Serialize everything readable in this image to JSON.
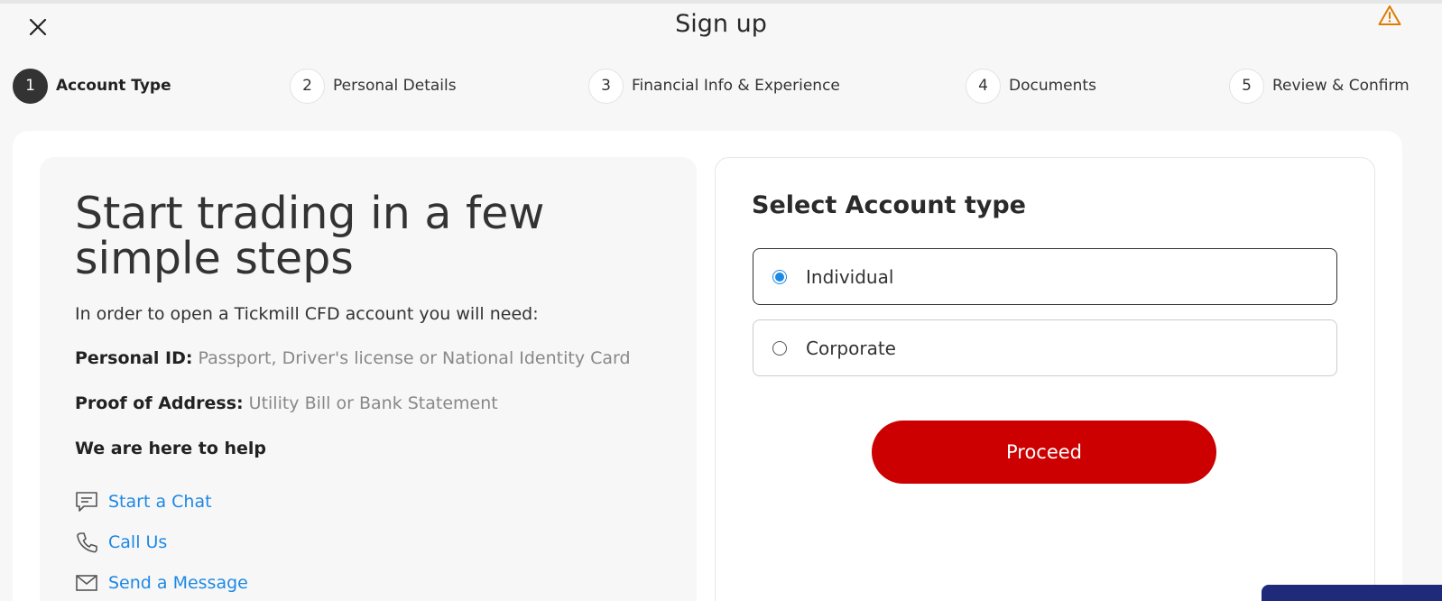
{
  "header": {
    "title": "Sign up"
  },
  "steps": [
    {
      "num": "1",
      "label": "Account Type",
      "active": true
    },
    {
      "num": "2",
      "label": "Personal Details",
      "active": false
    },
    {
      "num": "3",
      "label": "Financial Info & Experience",
      "active": false
    },
    {
      "num": "4",
      "label": "Documents",
      "active": false
    },
    {
      "num": "5",
      "label": "Review & Confirm",
      "active": false
    }
  ],
  "info": {
    "headline": "Start trading in a few simple steps",
    "intro": "In order to open a Tickmill CFD account you will need:",
    "requirements": [
      {
        "label": "Personal ID:",
        "value": "Passport, Driver's license or National Identity Card"
      },
      {
        "label": "Proof of Address:",
        "value": "Utility Bill or Bank Statement"
      }
    ],
    "help_heading": "We are here to help",
    "contacts": [
      {
        "label": "Start a Chat",
        "icon": "chat-icon"
      },
      {
        "label": "Call Us",
        "icon": "phone-icon"
      },
      {
        "label": "Send a Message",
        "icon": "mail-icon"
      }
    ]
  },
  "account_select": {
    "title": "Select Account type",
    "options": [
      {
        "label": "Individual",
        "selected": true
      },
      {
        "label": "Corporate",
        "selected": false
      }
    ],
    "proceed_label": "Proceed"
  },
  "colors": {
    "accent_red": "#cc0000",
    "link_blue": "#1e88e5",
    "warning_orange": "#e07b00",
    "chat_widget": "#1f2a7a"
  }
}
